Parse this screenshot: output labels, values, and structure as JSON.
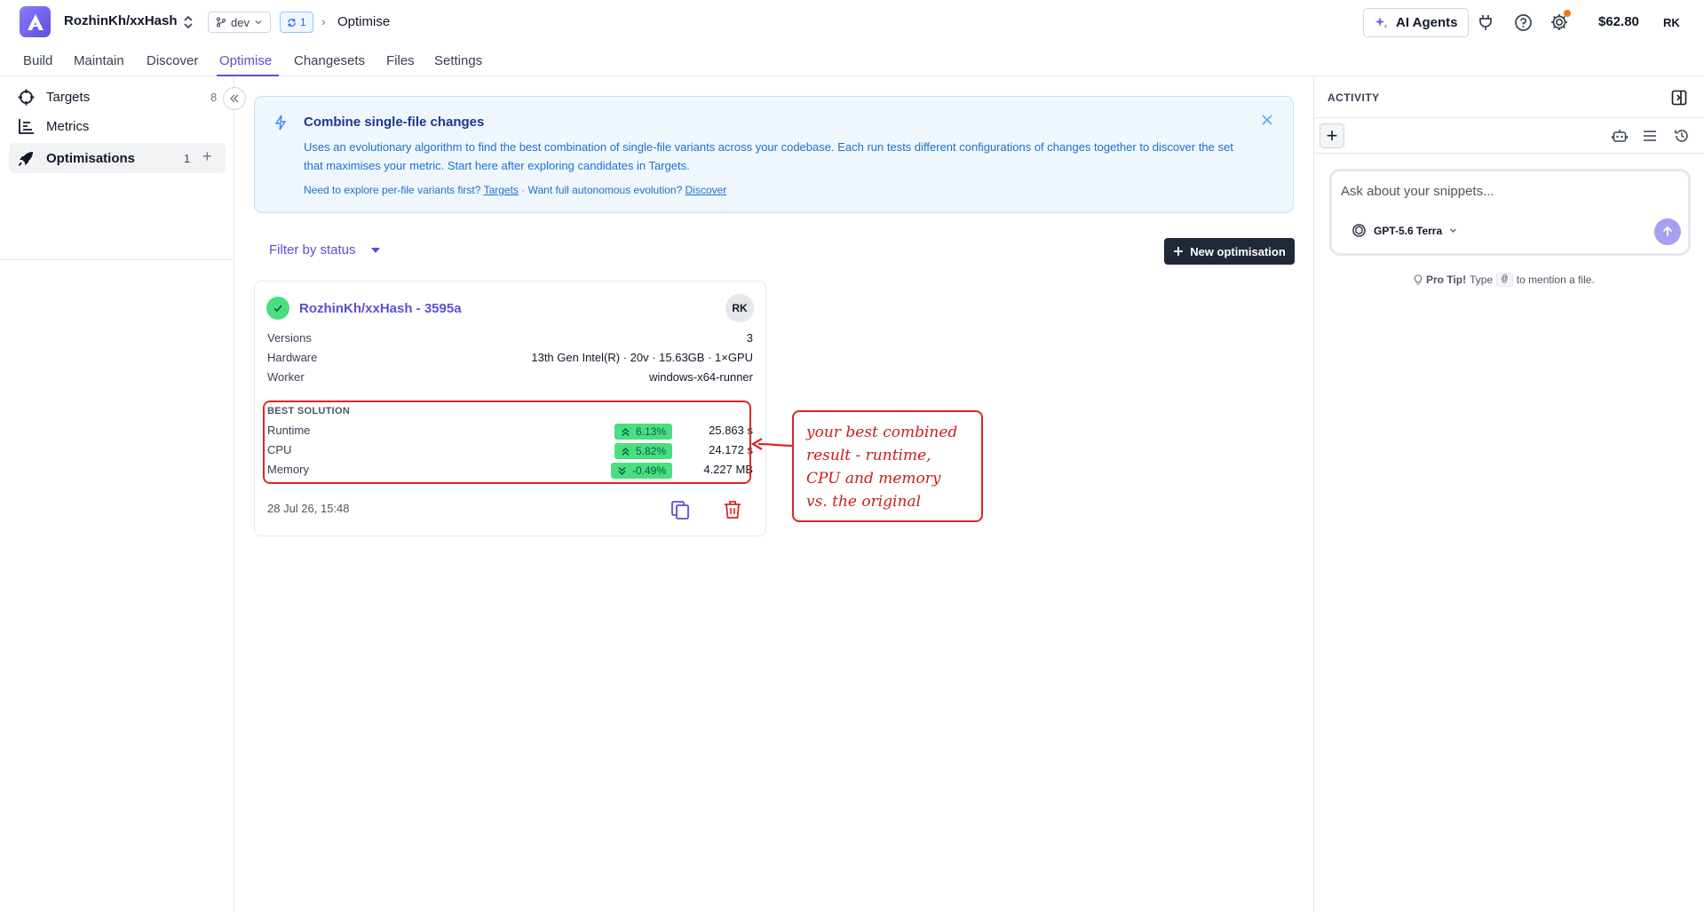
{
  "header": {
    "repo_name": "RozhinKh/xxHash",
    "branch": "dev",
    "sync_count": "1",
    "breadcrumb_current": "Optimise",
    "ai_agents_label": "AI Agents",
    "credits": "$62.80",
    "user_initials": "RK"
  },
  "tabs": [
    "Build",
    "Maintain",
    "Discover",
    "Optimise",
    "Changesets",
    "Files",
    "Settings"
  ],
  "active_tab": "Optimise",
  "sidebar": {
    "items": [
      {
        "label": "Targets",
        "count": "8",
        "icon": "crosshair-icon"
      },
      {
        "label": "Metrics",
        "count": "",
        "icon": "bar-chart-icon"
      },
      {
        "label": "Optimisations",
        "count": "1",
        "icon": "rocket-icon"
      }
    ]
  },
  "info": {
    "title": "Combine single-file changes",
    "body": "Uses an evolutionary algorithm to find the best combination of single-file variants across your codebase. Each run tests different configurations of changes together to discover the set that maximises your metric. Start here after exploring candidates in Targets.",
    "links_prefix": "Need to explore per-file variants first?",
    "link_targets": "Targets",
    "links_middle": "· Want full autonomous evolution?",
    "link_discover": "Discover"
  },
  "filter_label": "Filter by status",
  "new_button_label": "New optimisation",
  "card": {
    "title": "RozhinKh/xxHash - 3595a",
    "avatar": "RK",
    "versions_label": "Versions",
    "versions_value": "3",
    "hardware_label": "Hardware",
    "hardware_value": "13th Gen Intel(R) · 20v · 15.63GB · 1×GPU",
    "worker_label": "Worker",
    "worker_value": "windows-x64-runner",
    "best_label": "BEST SOLUTION",
    "metrics": [
      {
        "label": "Runtime",
        "change": "6.13%",
        "direction": "up",
        "value": "25.863 s"
      },
      {
        "label": "CPU",
        "change": "5.82%",
        "direction": "up",
        "value": "24.172 s"
      },
      {
        "label": "Memory",
        "change": "-0.49%",
        "direction": "down",
        "value": "4.227 MB"
      }
    ],
    "date": "28 Jul 26, 15:48"
  },
  "annotation": {
    "lines": [
      "your best combined",
      "result - runtime,",
      "CPU and memory",
      "vs. the original"
    ]
  },
  "activity": {
    "title": "ACTIVITY",
    "chat_placeholder": "Ask about your snippets...",
    "model": "GPT-5.6 Terra",
    "tip_bold": "Pro Tip!",
    "tip_pre": "Type",
    "tip_key": "@",
    "tip_post": "to mention a file."
  },
  "colors": {
    "accent": "#5b4fd6",
    "success": "#4ade80",
    "annotation": "#dc2626",
    "info_bg": "#eff6fc"
  }
}
